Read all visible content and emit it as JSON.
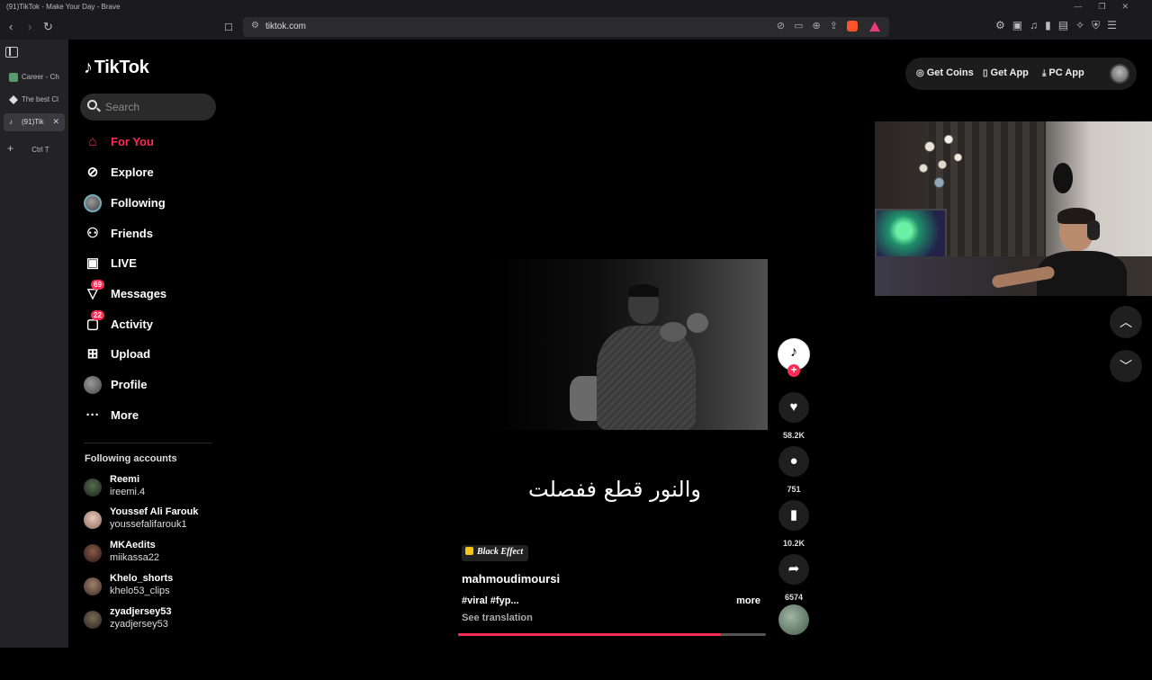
{
  "window": {
    "title": "(91)TikTok - Make Your Day - Brave"
  },
  "browser": {
    "url": "tiktok.com",
    "tabs": [
      {
        "label": "Career - Ch"
      },
      {
        "label": "The best Cl"
      },
      {
        "label": "(91)Tik"
      }
    ],
    "new_tab_label": "Ctrl T"
  },
  "app": {
    "logo_text": "TikTok",
    "search_placeholder": "Search",
    "nav": [
      {
        "label": "For You",
        "icon": "home-icon"
      },
      {
        "label": "Explore",
        "icon": "compass-icon"
      },
      {
        "label": "Following",
        "icon": "following-avatar-icon"
      },
      {
        "label": "Friends",
        "icon": "friends-icon"
      },
      {
        "label": "LIVE",
        "icon": "live-icon"
      },
      {
        "label": "Messages",
        "icon": "messages-icon",
        "badge": "69"
      },
      {
        "label": "Activity",
        "icon": "activity-icon",
        "badge": "22"
      },
      {
        "label": "Upload",
        "icon": "upload-icon"
      },
      {
        "label": "Profile",
        "icon": "profile-avatar-icon"
      },
      {
        "label": "More",
        "icon": "more-icon"
      }
    ],
    "following_header": "Following accounts",
    "following_accounts": [
      {
        "name": "Reemi",
        "username": "ireemi.4"
      },
      {
        "name": "Youssef Ali Farouk",
        "username": "youssefalifarouk1"
      },
      {
        "name": "MKAedits",
        "username": "miikassa22"
      },
      {
        "name": "Khelo_shorts",
        "username": "khelo53_clips"
      },
      {
        "name": "zyadjersey53",
        "username": "zyadjersey53"
      }
    ],
    "top_buttons": {
      "coins": "Get Coins",
      "app": "Get App",
      "pc": "PC App"
    }
  },
  "video": {
    "caption": "والنور قطع ففصلت",
    "effect": "Black Effect",
    "author": "mahmoudimoursi",
    "description": "#viral #fyp...",
    "more": "more",
    "see_translation": "See translation",
    "progress_fraction": 0.855,
    "likes": "58.2K",
    "comments": "751",
    "bookmarks": "10.2K",
    "shares": "6574"
  },
  "colors": {
    "accent": "#fe2c55",
    "background": "#000000"
  }
}
